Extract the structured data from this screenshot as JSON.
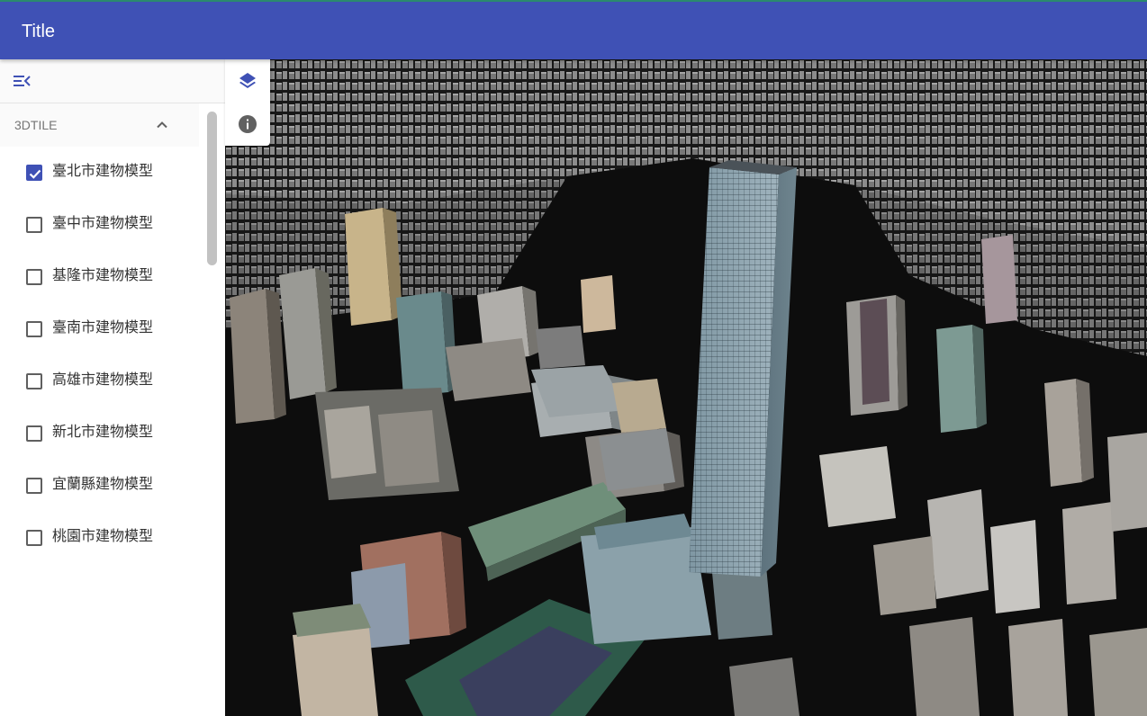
{
  "app_bar": {
    "title": "Title",
    "color": "#3f51b5"
  },
  "sidebar": {
    "collapse_icon": "menu-collapse-icon",
    "group": {
      "title": "3DTILE",
      "expanded": true,
      "expand_icon": "chevron-up-icon"
    },
    "layers": [
      {
        "label": "臺北市建物模型",
        "checked": true
      },
      {
        "label": "臺中市建物模型",
        "checked": false
      },
      {
        "label": "基隆市建物模型",
        "checked": false
      },
      {
        "label": "臺南市建物模型",
        "checked": false
      },
      {
        "label": "高雄市建物模型",
        "checked": false
      },
      {
        "label": "新北市建物模型",
        "checked": false
      },
      {
        "label": "宜蘭縣建物模型",
        "checked": false
      },
      {
        "label": "桃園市建物模型",
        "checked": false
      }
    ],
    "checkbox_color": "#3f51b5"
  },
  "map_tools": [
    {
      "icon": "layers-icon",
      "color": "#3f51b5"
    },
    {
      "icon": "info-icon",
      "color": "#616161"
    }
  ],
  "map": {
    "background": "#0b0b0b"
  }
}
